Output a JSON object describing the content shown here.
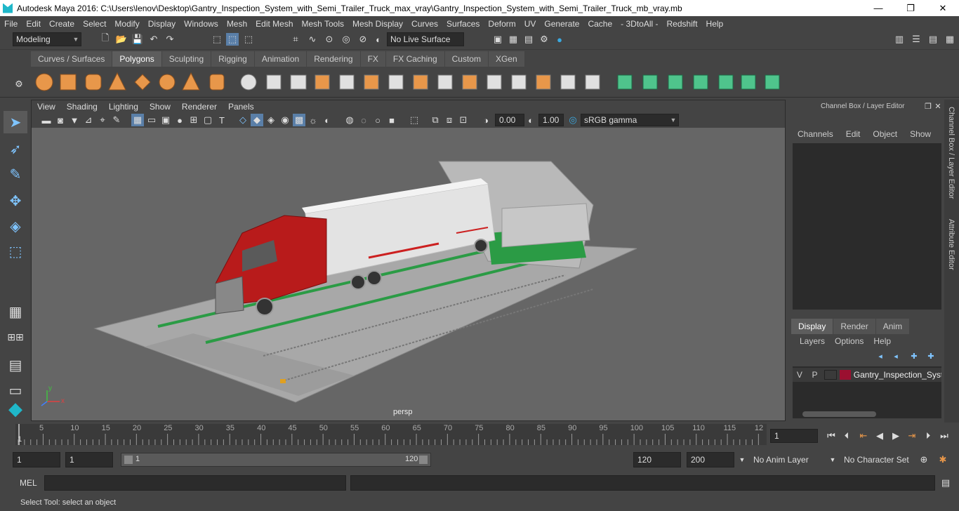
{
  "window": {
    "title": "Autodesk Maya 2016: C:\\Users\\lenov\\Desktop\\Gantry_Inspection_System_with_Semi_Trailer_Truck_max_vray\\Gantry_Inspection_System_with_Semi_Trailer_Truck_mb_vray.mb",
    "minimize": "—",
    "restore": "❐",
    "close": "✕"
  },
  "menu": [
    "File",
    "Edit",
    "Create",
    "Select",
    "Modify",
    "Display",
    "Windows",
    "Mesh",
    "Edit Mesh",
    "Mesh Tools",
    "Mesh Display",
    "Curves",
    "Surfaces",
    "Deform",
    "UV",
    "Generate",
    "Cache",
    "- 3DtoAll -",
    "Redshift",
    "Help"
  ],
  "status": {
    "mode": "Modeling",
    "live_surface": "No Live Surface"
  },
  "shelf_tabs": [
    "Curves / Surfaces",
    "Polygons",
    "Sculpting",
    "Rigging",
    "Animation",
    "Rendering",
    "FX",
    "FX Caching",
    "Custom",
    "XGen"
  ],
  "shelf_active": "Polygons",
  "viewport": {
    "menu": [
      "View",
      "Shading",
      "Lighting",
      "Show",
      "Renderer",
      "Panels"
    ],
    "exposure": "0.00",
    "gamma": "1.00",
    "colorspace": "sRGB gamma",
    "camera_label": "persp",
    "axis_x": "x",
    "axis_y": "y"
  },
  "channel_box": {
    "title": "Channel Box / Layer Editor",
    "menu": [
      "Channels",
      "Edit",
      "Object",
      "Show"
    ],
    "layer_tabs": [
      "Display",
      "Render",
      "Anim"
    ],
    "layer_active": "Display",
    "layer_menu": [
      "Layers",
      "Options",
      "Help"
    ],
    "layer": {
      "v": "V",
      "p": "P",
      "name": "Gantry_Inspection_Syst",
      "color": "#9b1030"
    }
  },
  "side_tabs": [
    "Channel Box / Layer Editor",
    "Attribute Editor"
  ],
  "timeline": {
    "ticks": [
      "5",
      "10",
      "15",
      "20",
      "25",
      "30",
      "35",
      "40",
      "45",
      "50",
      "55",
      "60",
      "65",
      "70",
      "75",
      "80",
      "85",
      "90",
      "95",
      "100",
      "105",
      "110",
      "115",
      "12"
    ],
    "start_marker": "1",
    "current_frame": "1"
  },
  "range": {
    "start": "1",
    "playback_start": "1",
    "slider_start": "1",
    "slider_end": "120",
    "playback_end": "120",
    "end": "200",
    "anim_layer": "No Anim Layer",
    "character_set": "No Character Set"
  },
  "cmd": {
    "label": "MEL"
  },
  "help_text": "Select Tool: select an object"
}
